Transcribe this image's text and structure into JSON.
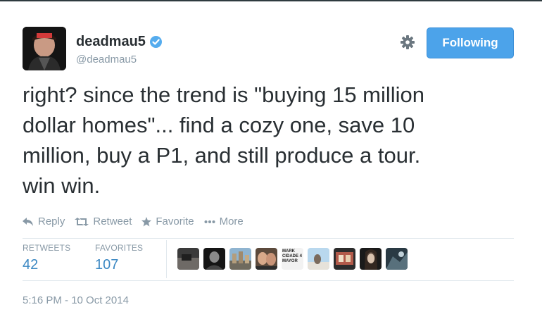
{
  "user": {
    "display_name": "deadmau5",
    "handle": "@deadmau5",
    "verified": true
  },
  "follow_button": {
    "label": "Following"
  },
  "tweet": {
    "lines": [
      "right? since the trend is \"buying 15 million",
      "dollar homes\"... find a cozy one, save 10",
      "million, buy a P1, and still produce a tour.",
      "win win."
    ]
  },
  "actions": {
    "reply": "Reply",
    "retweet": "Retweet",
    "favorite": "Favorite",
    "more": "More"
  },
  "stats": {
    "retweets_label": "RETWEETS",
    "retweets_value": "42",
    "favorites_label": "FAVORITES",
    "favorites_value": "107"
  },
  "favoriters": [
    {
      "name": "favoriter-avatar-1"
    },
    {
      "name": "favoriter-avatar-2"
    },
    {
      "name": "favoriter-avatar-3"
    },
    {
      "name": "favoriter-avatar-4"
    },
    {
      "name": "favoriter-avatar-5",
      "text": "MARK CIDADE 4 MAYOR"
    },
    {
      "name": "favoriter-avatar-6"
    },
    {
      "name": "favoriter-avatar-7"
    },
    {
      "name": "favoriter-avatar-8"
    },
    {
      "name": "favoriter-avatar-9"
    }
  ],
  "timestamp": "5:16 PM - 10 Oct 2014",
  "colors": {
    "accent": "#55acee",
    "button": "#4ca3ea",
    "stat_value": "#3b88c3",
    "muted": "#8899a6",
    "text": "#292f33"
  },
  "icons": {
    "verified": "verified-badge-icon",
    "gear": "gear-icon",
    "reply": "reply-icon",
    "retweet": "retweet-icon",
    "favorite": "star-icon",
    "more": "more-dots-icon"
  }
}
